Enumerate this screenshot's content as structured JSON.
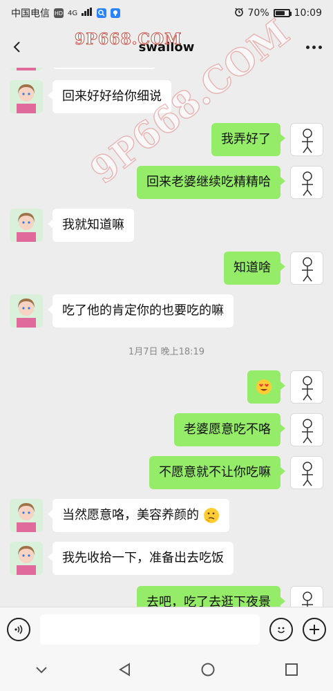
{
  "status_bar": {
    "carrier": "中国电信",
    "hd": "HD",
    "network": "4G",
    "battery": "70%",
    "battery_level": 0.7,
    "time": "10:09"
  },
  "header": {
    "title": "swallow",
    "watermark_top": "9P668.COM"
  },
  "watermark_diag": "9P668.COM",
  "messages": [
    {
      "side": "left",
      "text": "回来好好给你细说"
    },
    {
      "side": "right",
      "text": "我弄好了"
    },
    {
      "side": "right",
      "text": "回来老婆继续吃精精哈"
    },
    {
      "side": "left",
      "text": "我就知道嘛"
    },
    {
      "side": "right",
      "text": "知道啥"
    },
    {
      "side": "left",
      "text": "吃了他的肯定你的也要吃的嘛"
    },
    {
      "side": "right",
      "text": "",
      "emoji": "heart-eyes-emoji"
    },
    {
      "side": "right",
      "text": "老婆愿意吃不咯"
    },
    {
      "side": "right",
      "text": "不愿意就不让你吃嘛"
    },
    {
      "side": "left",
      "text": "当然愿意咯，美容养颜的",
      "emoji": "thinking-emoji"
    },
    {
      "side": "left",
      "text": "我先收拾一下，准备出去吃饭"
    },
    {
      "side": "right",
      "text": "去吧，吃了去逛下夜景"
    }
  ],
  "timestamp": "1月7日 晚上18:19",
  "input": {
    "placeholder": ""
  },
  "colors": {
    "background": "#ededed",
    "bubble_mine": "#95ec69",
    "bubble_theirs": "#ffffff"
  }
}
